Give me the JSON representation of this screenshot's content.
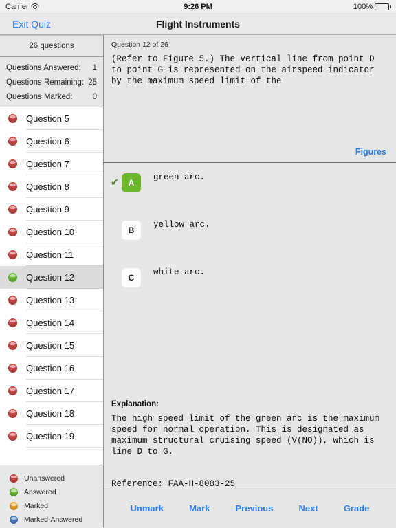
{
  "status_bar": {
    "carrier": "Carrier",
    "wifi_icon": "wifi-icon",
    "time": "9:26 PM",
    "battery_percent": "100%",
    "battery_icon": "battery-full-icon"
  },
  "navbar": {
    "exit_label": "Exit Quiz",
    "title": "Flight Instruments"
  },
  "sidebar": {
    "question_count_label": "26 questions",
    "stats": [
      {
        "label": "Questions Answered:",
        "value": "1"
      },
      {
        "label": "Questions Remaining:",
        "value": "25"
      },
      {
        "label": "Questions Marked:",
        "value": "0"
      }
    ],
    "questions": [
      {
        "label": "Question 5",
        "status": "red",
        "selected": false
      },
      {
        "label": "Question 6",
        "status": "red",
        "selected": false
      },
      {
        "label": "Question 7",
        "status": "red",
        "selected": false
      },
      {
        "label": "Question 8",
        "status": "red",
        "selected": false
      },
      {
        "label": "Question 9",
        "status": "red",
        "selected": false
      },
      {
        "label": "Question 10",
        "status": "red",
        "selected": false
      },
      {
        "label": "Question 11",
        "status": "red",
        "selected": false
      },
      {
        "label": "Question 12",
        "status": "green",
        "selected": true
      },
      {
        "label": "Question 13",
        "status": "red",
        "selected": false
      },
      {
        "label": "Question 14",
        "status": "red",
        "selected": false
      },
      {
        "label": "Question 15",
        "status": "red",
        "selected": false
      },
      {
        "label": "Question 16",
        "status": "red",
        "selected": false
      },
      {
        "label": "Question 17",
        "status": "red",
        "selected": false
      },
      {
        "label": "Question 18",
        "status": "red",
        "selected": false
      },
      {
        "label": "Question 19",
        "status": "red",
        "selected": false
      }
    ],
    "legend": [
      {
        "label": "Unanswered",
        "status": "red"
      },
      {
        "label": "Answered",
        "status": "green"
      },
      {
        "label": "Marked",
        "status": "orange"
      },
      {
        "label": "Marked-Answered",
        "status": "blue"
      }
    ]
  },
  "question_pane": {
    "index_label": "Question 12 of 26",
    "text": "(Refer to Figure 5.) The vertical line from point D\nto point G is represented on the airspeed indicator\nby the maximum speed limit of the",
    "figures_label": "Figures"
  },
  "answers": [
    {
      "letter": "A",
      "text": "green arc.",
      "selected": true,
      "check": "✔"
    },
    {
      "letter": "B",
      "text": "yellow arc.",
      "selected": false,
      "check": ""
    },
    {
      "letter": "C",
      "text": "white arc.",
      "selected": false,
      "check": ""
    }
  ],
  "explanation": {
    "title": "Explanation:",
    "body": "The high speed limit of the green arc is the maximum\nspeed for normal operation. This is designated as\nmaximum structural cruising speed (V(NO)), which is\nline D to G.",
    "reference": "Reference: FAA-H-8083-25"
  },
  "toolbar": [
    {
      "label": "Unmark"
    },
    {
      "label": "Mark"
    },
    {
      "label": "Previous"
    },
    {
      "label": "Next"
    },
    {
      "label": "Grade"
    }
  ],
  "colors": {
    "accent_blue": "#2f7ff0",
    "answered_green": "#6cb52d",
    "unanswered_red": "#cf4a47",
    "marked_orange": "#e8a82c",
    "marked_answered_blue": "#4f7fc6"
  }
}
